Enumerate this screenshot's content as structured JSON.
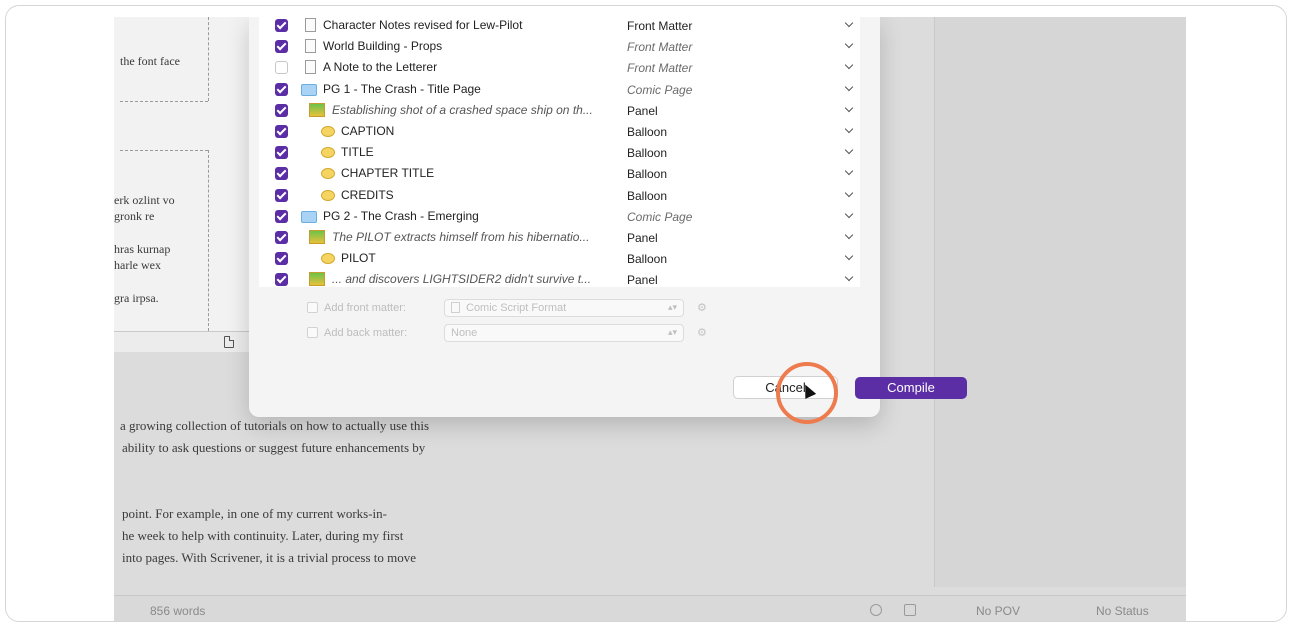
{
  "binder_rows": [
    {
      "checked": true,
      "icon": "doc",
      "title": "Character Notes revised for Lew-Pilot",
      "title_italic": false,
      "type": "Front Matter",
      "type_italic": false,
      "indent": 0
    },
    {
      "checked": true,
      "icon": "doc",
      "title": "World Building - Props",
      "title_italic": false,
      "type": "Front Matter",
      "type_italic": true,
      "indent": 0
    },
    {
      "checked": false,
      "icon": "doc",
      "title": "A Note to the Letterer",
      "title_italic": false,
      "type": "Front Matter",
      "type_italic": true,
      "indent": 0
    },
    {
      "checked": true,
      "icon": "folder",
      "title": "PG 1 - The Crash - Title Page",
      "title_italic": false,
      "type": "Comic Page",
      "type_italic": true,
      "indent": 0
    },
    {
      "checked": true,
      "icon": "panel",
      "title": "Establishing shot of a crashed space ship on th...",
      "title_italic": true,
      "type": "Panel",
      "type_italic": false,
      "indent": 1
    },
    {
      "checked": true,
      "icon": "balloon",
      "title": "CAPTION",
      "title_italic": false,
      "type": "Balloon",
      "type_italic": false,
      "indent": 2
    },
    {
      "checked": true,
      "icon": "balloon",
      "title": "TITLE",
      "title_italic": false,
      "type": "Balloon",
      "type_italic": false,
      "indent": 2
    },
    {
      "checked": true,
      "icon": "balloon",
      "title": "CHAPTER TITLE",
      "title_italic": false,
      "type": "Balloon",
      "type_italic": false,
      "indent": 2
    },
    {
      "checked": true,
      "icon": "balloon",
      "title": "CREDITS",
      "title_italic": false,
      "type": "Balloon",
      "type_italic": false,
      "indent": 2
    },
    {
      "checked": true,
      "icon": "folder",
      "title": "PG 2 - The Crash - Emerging",
      "title_italic": false,
      "type": "Comic Page",
      "type_italic": true,
      "indent": 0
    },
    {
      "checked": true,
      "icon": "panel",
      "title": "The PILOT extracts himself from his hibernatio...",
      "title_italic": true,
      "type": "Panel",
      "type_italic": false,
      "indent": 1
    },
    {
      "checked": true,
      "icon": "balloon",
      "title": "PILOT",
      "title_italic": false,
      "type": "Balloon",
      "type_italic": false,
      "indent": 2
    },
    {
      "checked": true,
      "icon": "panel",
      "title": "... and discovers LIGHTSIDER2 didn't survive t...",
      "title_italic": true,
      "type": "Panel",
      "type_italic": false,
      "indent": 1
    }
  ],
  "options": {
    "front_matter_label": "Add front matter:",
    "front_matter_value": "Comic Script Format",
    "back_matter_label": "Add back matter:",
    "back_matter_value": "None"
  },
  "buttons": {
    "cancel": "Cancel",
    "compile": "Compile"
  },
  "background_text": {
    "left_top": "the font face",
    "left_lines": [
      "erk ozlint vo",
      "gronk re",
      "hras kurnap",
      "harle wex",
      "gra irpsa."
    ],
    "body_lines": [
      "a growing collection of tutorials on how to actually use this",
      "ability to ask questions or suggest future enhancements by",
      "point. For example, in one of my current works-in-",
      "he week to help with continuity. Later, during my first",
      "into pages. With Scrivener, it is a trivial process to move"
    ]
  },
  "status_bar": {
    "word_count": "856 words",
    "pov": "No POV",
    "status": "No Status"
  },
  "colors": {
    "accent": "#5b2ea6",
    "highlight_ring": "#ee7b4e"
  }
}
